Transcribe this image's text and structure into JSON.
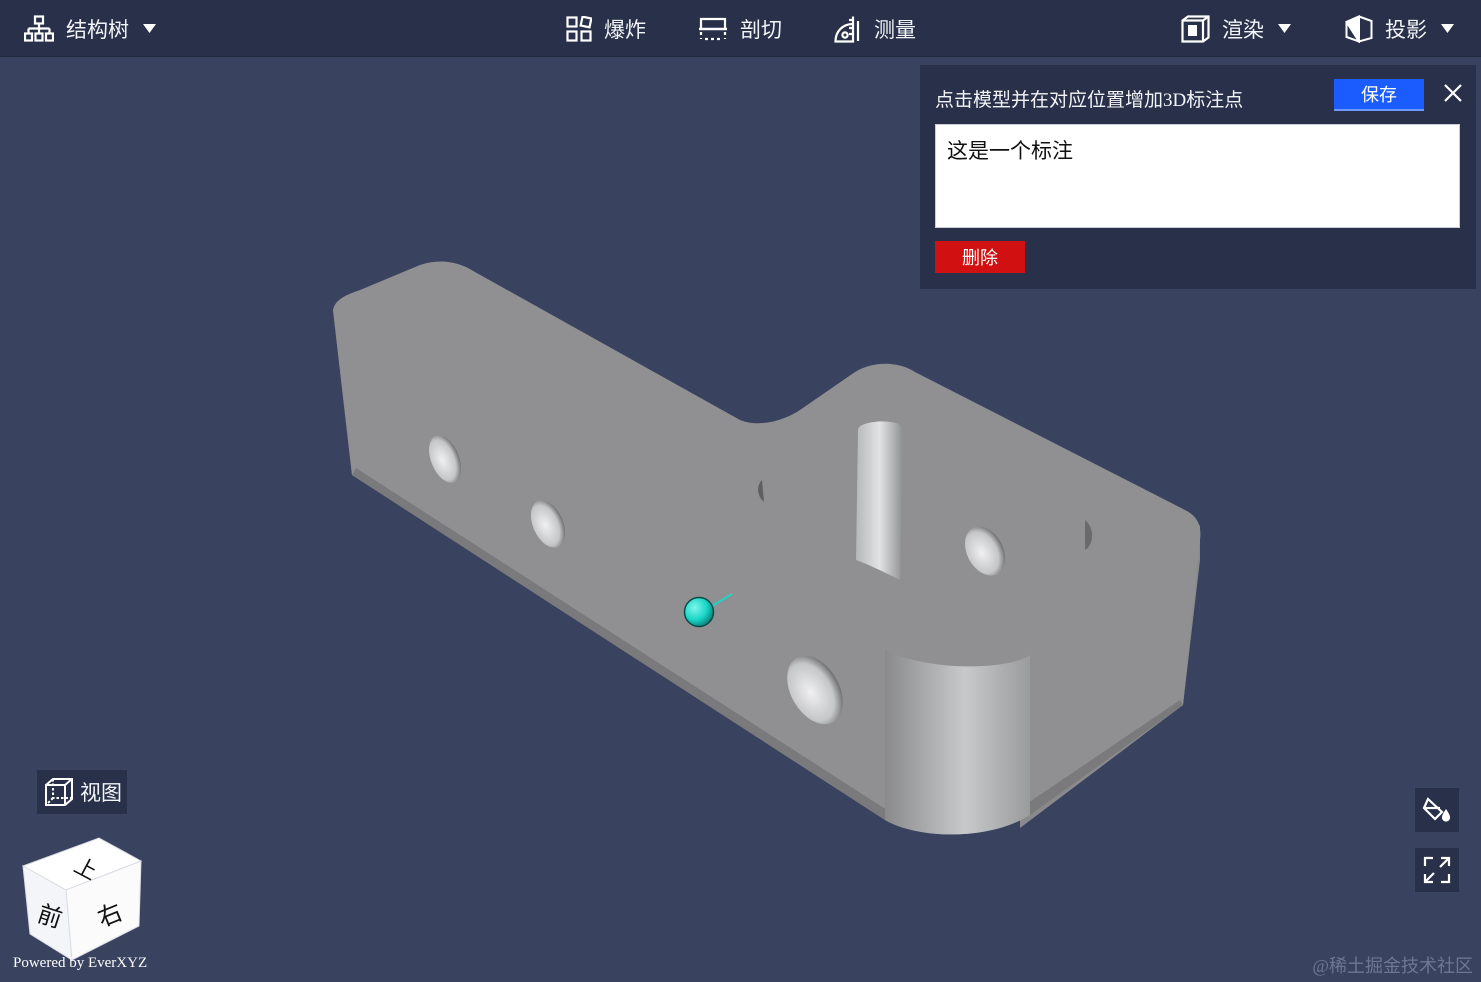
{
  "toolbar": {
    "structure_tree": "结构树",
    "explode": "爆炸",
    "section": "剖切",
    "measure": "测量",
    "render": "渲染",
    "projection": "投影"
  },
  "annotation": {
    "title": "点击模型并在对应位置增加3D标注点",
    "save_label": "保存",
    "text_value": "这是一个标注",
    "delete_label": "删除"
  },
  "view": {
    "label": "视图"
  },
  "nav_cube": {
    "top": "上",
    "front": "前",
    "right": "右"
  },
  "footer": {
    "powered_by": "Powered by EverXYZ",
    "watermark": "@稀土掘金技术社区"
  },
  "colors": {
    "background": "#39435f",
    "toolbar": "#283149",
    "save": "#1b5cff",
    "delete": "#d11111",
    "annotation_marker": "#19d6c8",
    "model": "#8f8f91"
  },
  "icons": [
    "structure-tree-icon",
    "explode-icon",
    "section-icon",
    "measure-icon",
    "render-icon",
    "projection-icon",
    "view-cube-icon",
    "paint-bucket-icon",
    "fullscreen-icon",
    "close-icon"
  ]
}
